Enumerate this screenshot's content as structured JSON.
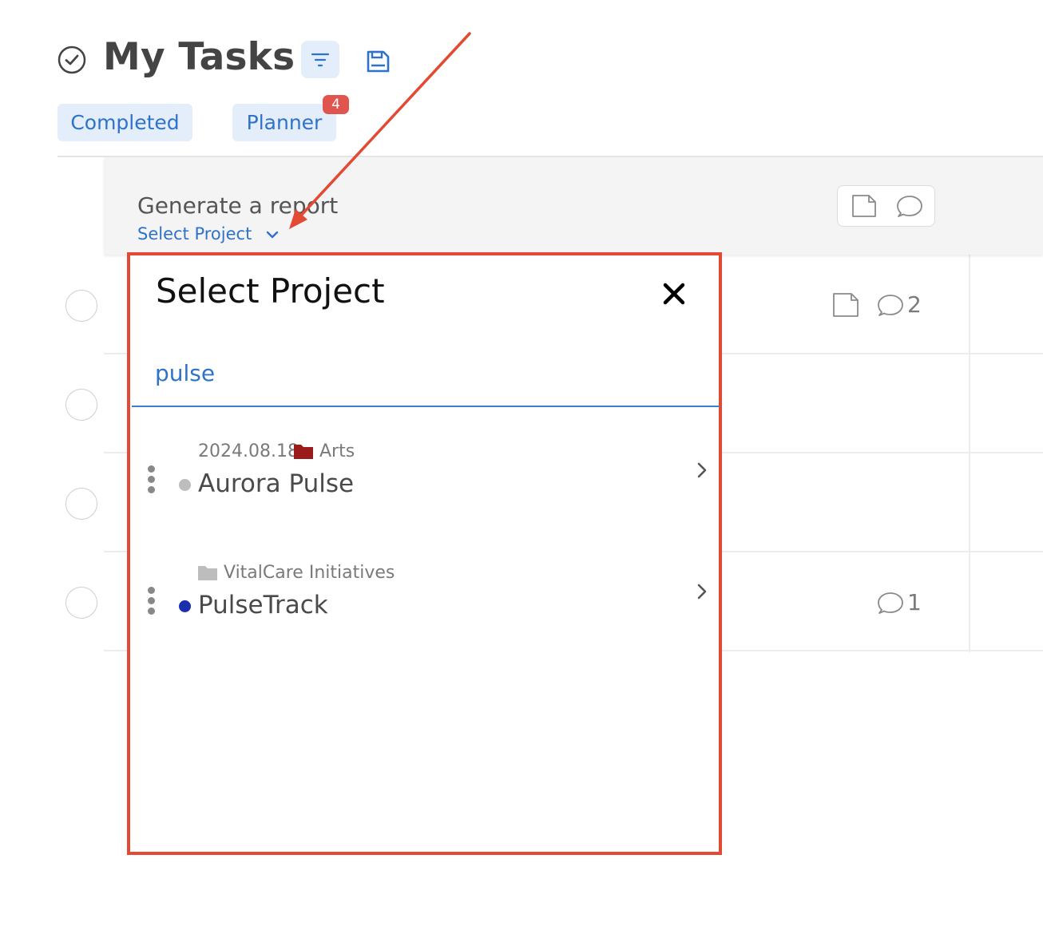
{
  "header": {
    "title": "My Tasks",
    "check_icon": "circle-check-icon",
    "filter_icon": "filter-icon",
    "save_icon": "save-icon"
  },
  "tabs": [
    {
      "label": "Completed"
    },
    {
      "label": "Planner",
      "badge": "4"
    }
  ],
  "report_row": {
    "title": "Generate a report",
    "select_project_label": "Select Project",
    "icons": [
      "note-icon",
      "comment-icon"
    ]
  },
  "task_rows": [
    {
      "comment_count": "2",
      "icons": [
        "note-icon",
        "comment-icon"
      ]
    },
    {
      "comment_count": ""
    },
    {
      "comment_count": ""
    },
    {
      "comment_count": "1",
      "icons": [
        "comment-icon"
      ]
    }
  ],
  "modal": {
    "title": "Select Project",
    "close_icon": "close-icon",
    "search_value": "pulse",
    "projects": [
      {
        "date": "2024.08.18",
        "folder": "Arts",
        "folder_color": "#9b1b1b",
        "name": "Aurora Pulse",
        "dot_color": "#bdbdbd"
      },
      {
        "date": "",
        "folder": "VitalCare Initiatives",
        "folder_color": "#bdbdbd",
        "name": "PulseTrack",
        "dot_color": "#1a2fae"
      }
    ]
  },
  "colors": {
    "accent": "#2f72c9",
    "annotation": "#e24a33",
    "badge": "#e0564f"
  }
}
